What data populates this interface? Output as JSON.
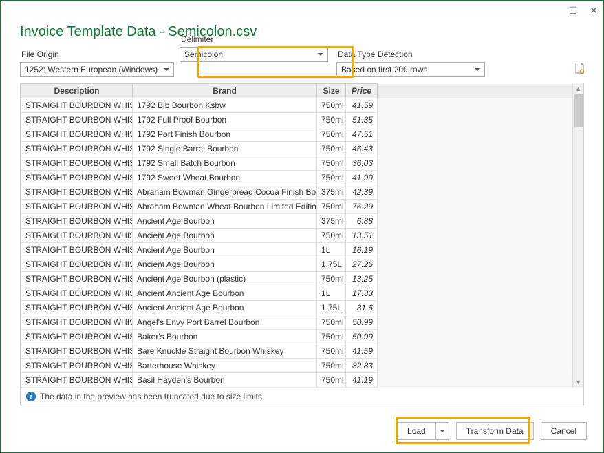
{
  "titlebar": {
    "maximize_glyph": "☐",
    "close_glyph": "✕"
  },
  "dialog_title": "Invoice Template Data - Semicolon.csv",
  "dropdowns": {
    "origin": {
      "label": "File Origin",
      "value": "1252: Western European (Windows)"
    },
    "delimiter": {
      "label": "Delimiter",
      "value": "Semicolon"
    },
    "detection": {
      "label": "Data Type Detection",
      "value": "Based on first 200 rows"
    }
  },
  "table": {
    "headers": {
      "description": "Description",
      "brand": "Brand",
      "size": "Size",
      "price": "Price"
    },
    "rows": [
      {
        "description": "STRAIGHT BOURBON WHISKEY",
        "brand": "1792 Bib Bourbon Ksbw",
        "size": "750ml",
        "price": "41.59"
      },
      {
        "description": "STRAIGHT BOURBON WHISKEY",
        "brand": "1792 Full Proof Bourbon",
        "size": "750ml",
        "price": "51.35"
      },
      {
        "description": "STRAIGHT BOURBON WHISKEY",
        "brand": "1792 Port Finish Bourbon",
        "size": "750ml",
        "price": "47.51"
      },
      {
        "description": "STRAIGHT BOURBON WHISKEY",
        "brand": "1792 Single Barrel Bourbon",
        "size": "750ml",
        "price": "46.43"
      },
      {
        "description": "STRAIGHT BOURBON WHISKEY",
        "brand": "1792 Small Batch Bourbon",
        "size": "750ml",
        "price": "36.03"
      },
      {
        "description": "STRAIGHT BOURBON WHISKEY",
        "brand": "1792 Sweet Wheat Bourbon",
        "size": "750ml",
        "price": "41.99"
      },
      {
        "description": "STRAIGHT BOURBON WHISKEY",
        "brand": "Abraham Bowman Gingerbread Cocoa Finish Bourbon",
        "size": "375ml",
        "price": "42.39"
      },
      {
        "description": "STRAIGHT BOURBON WHISKEY",
        "brand": "Abraham Bowman Wheat Bourbon Limited Edition",
        "size": "750ml",
        "price": "76.29"
      },
      {
        "description": "STRAIGHT BOURBON WHISKEY",
        "brand": "Ancient Age Bourbon",
        "size": "375ml",
        "price": "6.88"
      },
      {
        "description": "STRAIGHT BOURBON WHISKEY",
        "brand": "Ancient Age Bourbon",
        "size": "750ml",
        "price": "13.51"
      },
      {
        "description": "STRAIGHT BOURBON WHISKEY",
        "brand": "Ancient Age Bourbon",
        "size": "1L",
        "price": "16.19"
      },
      {
        "description": "STRAIGHT BOURBON WHISKEY",
        "brand": "Ancient Age Bourbon",
        "size": "1.75L",
        "price": "27.26"
      },
      {
        "description": "STRAIGHT BOURBON WHISKEY",
        "brand": "Ancient Age Bourbon (plastic)",
        "size": "750ml",
        "price": "13.25"
      },
      {
        "description": "STRAIGHT BOURBON WHISKEY",
        "brand": "Ancient Ancient Age Bourbon",
        "size": "1L",
        "price": "17.33"
      },
      {
        "description": "STRAIGHT BOURBON WHISKEY",
        "brand": "Ancient Ancient Age Bourbon",
        "size": "1.75L",
        "price": "31.6"
      },
      {
        "description": "STRAIGHT BOURBON WHISKEY",
        "brand": "Angel's Envy Port Barrel Bourbon",
        "size": "750ml",
        "price": "50.99"
      },
      {
        "description": "STRAIGHT BOURBON WHISKEY",
        "brand": "Baker's Bourbon",
        "size": "750ml",
        "price": "50.99"
      },
      {
        "description": "STRAIGHT BOURBON WHISKEY",
        "brand": "Bare Knuckle Straight Bourbon Whiskey",
        "size": "750ml",
        "price": "41.59"
      },
      {
        "description": "STRAIGHT BOURBON WHISKEY",
        "brand": "Barterhouse Whiskey",
        "size": "750ml",
        "price": "82.83"
      },
      {
        "description": "STRAIGHT BOURBON WHISKEY",
        "brand": "Basil Hayden's Bourbon",
        "size": "750ml",
        "price": "41.19"
      }
    ]
  },
  "info_message": "The data in the preview has been truncated due to size limits.",
  "buttons": {
    "load": "Load",
    "transform": "Transform Data",
    "cancel": "Cancel"
  }
}
